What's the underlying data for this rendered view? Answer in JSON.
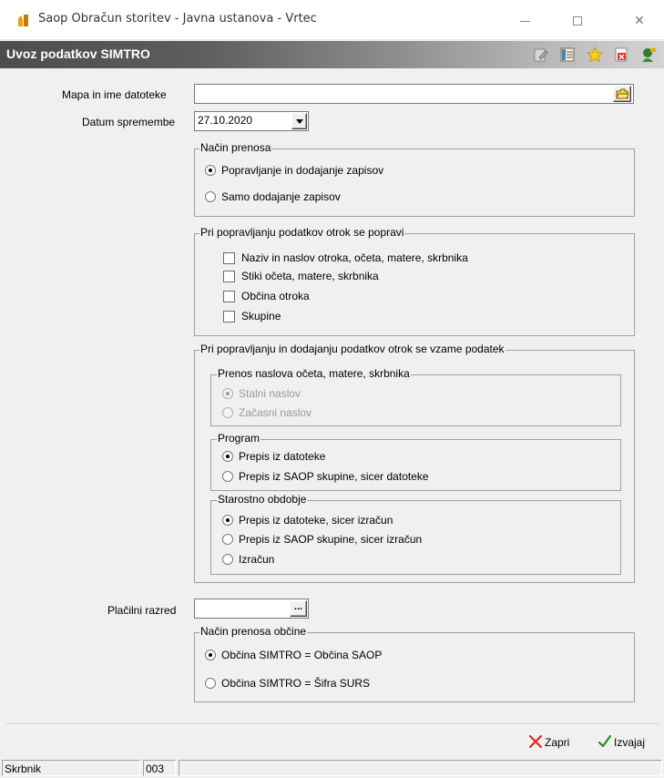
{
  "window": {
    "title": "Saop Obračun storitev - Javna ustanova - Vrtec",
    "minimize_icon": "minimize-icon",
    "maximize_icon": "maximize-icon",
    "close_icon": "close-icon",
    "close_glyph": "✕"
  },
  "form": {
    "title": "Uvoz podatkov SIMTRO",
    "toolbar_icons": [
      "edit-icon",
      "list-icon",
      "star-icon",
      "delete-icon",
      "exit-icon"
    ]
  },
  "fields": {
    "file_label": "Mapa in ime datoteke",
    "file_value": "",
    "date_label": "Datum spremembe",
    "date_value": "27.10.2020",
    "class_label": "Plačilni razred",
    "class_value": "",
    "ellipsis": "..."
  },
  "transfer_mode": {
    "title": "Način prenosa",
    "options": [
      "Popravljanje in dodajanje zapisov",
      "Samo dodajanje zapisov"
    ],
    "selected": 0
  },
  "update_group": {
    "title": "Pri popravljanju podatkov otrok se popravi",
    "options": [
      "Naziv in naslov otroka, očeta, matere, skrbnika",
      "Stiki očeta, matere, skrbnika",
      "Občina otroka",
      "Skupine"
    ]
  },
  "take_group": {
    "title": "Pri popravljanju in dodajanju podatkov otrok se vzame podatek",
    "address": {
      "title": "Prenos naslova očeta, matere, skrbnika",
      "options": [
        "Stalni naslov",
        "Začasni naslov"
      ],
      "selected": 0
    },
    "program": {
      "title": "Program",
      "options": [
        "Prepis iz datoteke",
        "Prepis iz SAOP skupine, sicer datoteke"
      ],
      "selected": 0
    },
    "age": {
      "title": "Starostno obdobje",
      "options": [
        "Prepis iz datoteke, sicer izračun",
        "Prepis iz SAOP skupine, sicer izračun",
        "Izračun"
      ],
      "selected": 0
    }
  },
  "municipality": {
    "title": "Način prenosa občine",
    "options": [
      "Občina SIMTRO = Občina SAOP",
      "Občina SIMTRO = Šifra SURS"
    ],
    "selected": 0
  },
  "actions": {
    "close_label": "Zapri",
    "run_label": "Izvajaj",
    "close_color": "#d62b1f",
    "run_color": "#2d8a2d"
  },
  "status": {
    "user": "Skrbnik",
    "code": "003"
  }
}
